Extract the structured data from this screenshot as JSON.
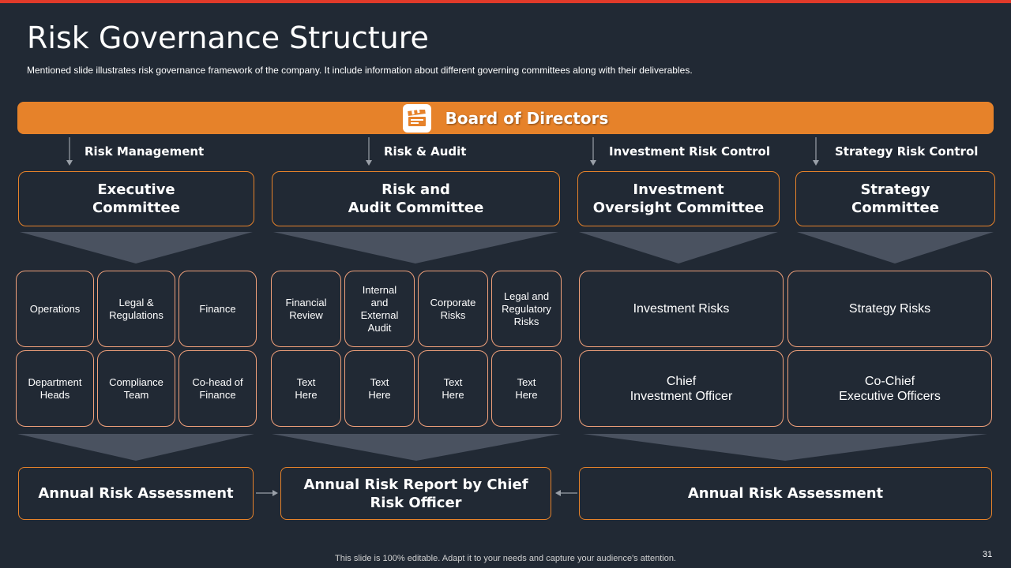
{
  "slide": {
    "title": "Risk Governance Structure",
    "subtitle": "Mentioned slide illustrates risk governance  framework of the company. It include information about different governing  committees along with their deliverables.",
    "footer": "This slide is 100% editable. Adapt it to your needs and capture your audience's attention.",
    "page_number": "31"
  },
  "board": {
    "label": "Board of Directors",
    "icon": "clapperboard-icon"
  },
  "categories": [
    "Risk Management",
    "Risk & Audit",
    "Investment Risk Control",
    "Strategy Risk Control"
  ],
  "committees": [
    "Executive\nCommittee",
    "Risk and\nAudit Committee",
    "Investment\nOversight Committee",
    "Strategy\nCommittee"
  ],
  "items": {
    "executive": [
      "Operations",
      "Legal &\nRegulations",
      "Finance",
      "Department\nHeads",
      "Compliance\nTeam",
      "Co-head of\nFinance"
    ],
    "audit": [
      "Financial\nReview",
      "Internal\nand\nExternal\nAudit",
      "Corporate\nRisks",
      "Legal and\nRegulatory\nRisks",
      "Text\nHere",
      "Text\nHere",
      "Text\nHere",
      "Text\nHere"
    ],
    "investment": [
      "Investment  Risks",
      "Chief\nInvestment  Officer"
    ],
    "strategy": [
      "Strategy Risks",
      "Co-Chief\nExecutive Officers"
    ]
  },
  "outcomes": [
    "Annual Risk Assessment",
    "Annual Risk Report by Chief\nRisk Officer",
    "Annual Risk Assessment"
  ],
  "colors": {
    "accent": "#e6822a",
    "background": "#212934",
    "top_bar": "#e03a2a",
    "cell_border": "#f0a07a",
    "chevron": "#4a5260"
  }
}
